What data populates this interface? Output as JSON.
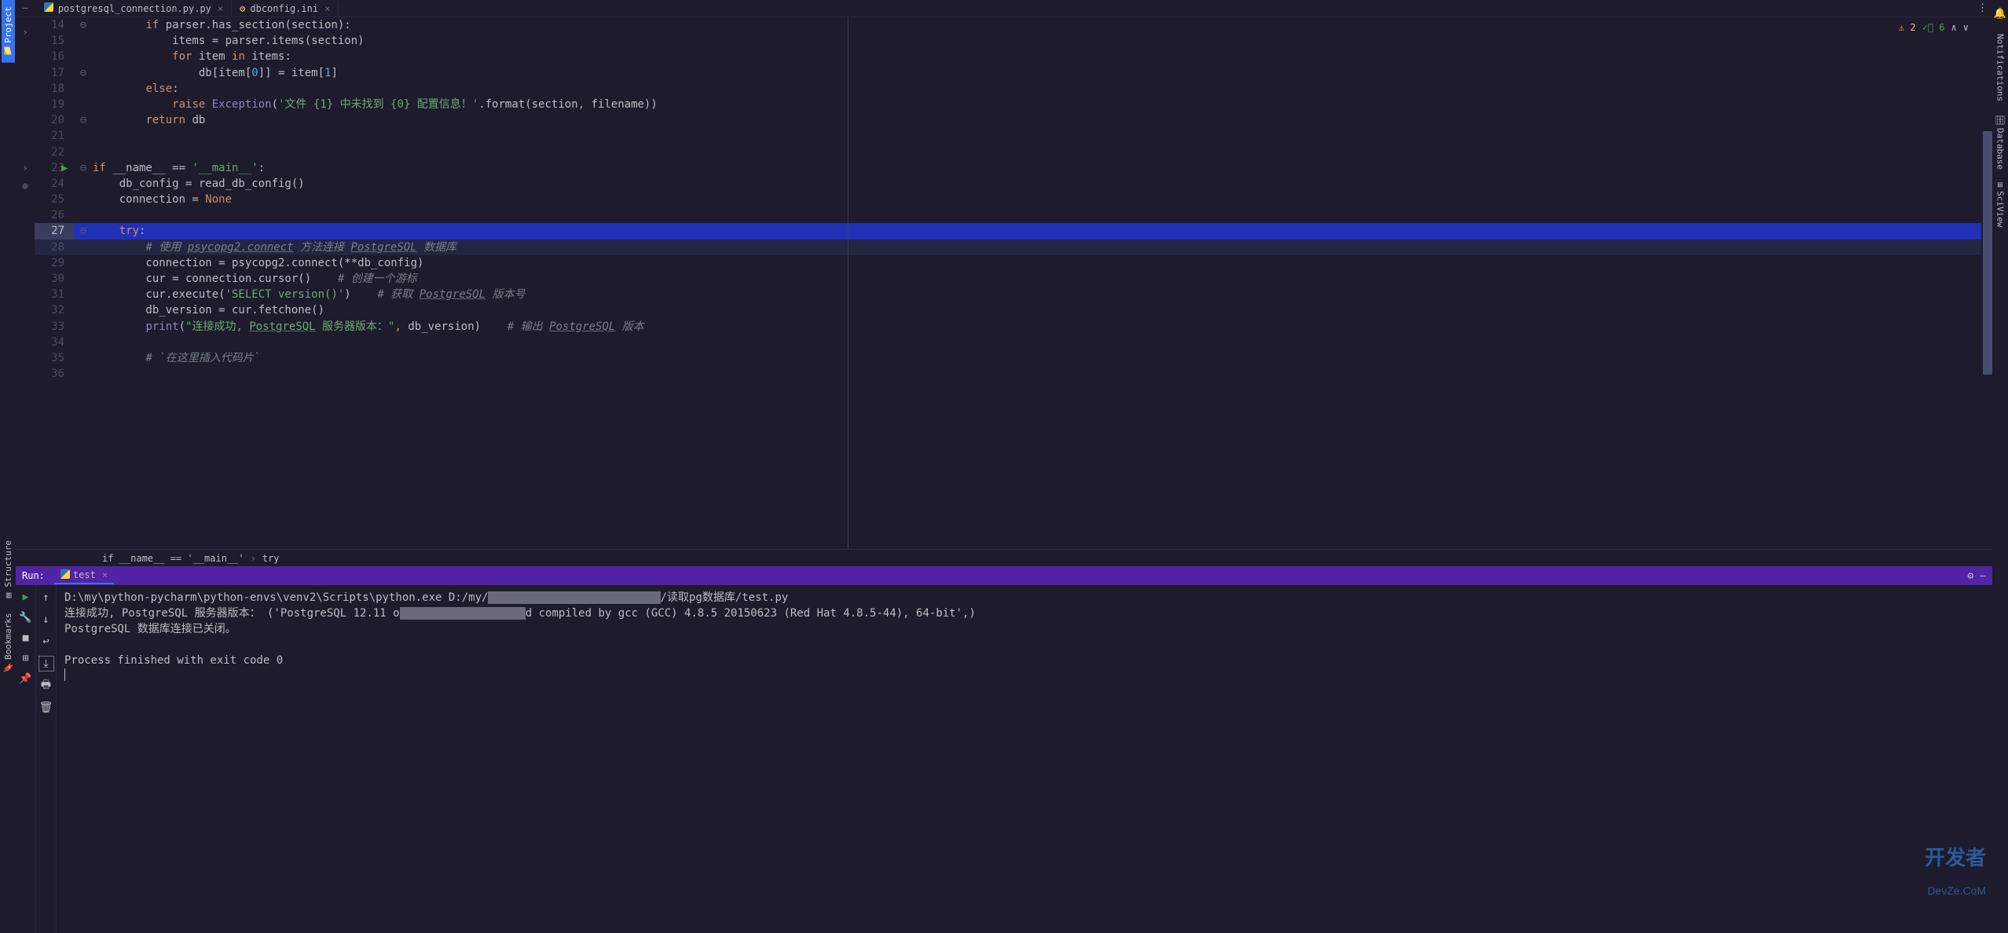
{
  "tabs": [
    {
      "name": "postgresql_connection.py.py",
      "active": true
    },
    {
      "name": "dbconfig.ini",
      "active": false
    }
  ],
  "left_tools": {
    "project": "Project",
    "structure": "Structure",
    "bookmarks": "Bookmarks"
  },
  "right_tools": {
    "notifications": "Notifications",
    "database": "Database",
    "sciview": "SciView"
  },
  "indicators": {
    "warnings": "2",
    "typos": "6"
  },
  "code": {
    "lines": [
      {
        "n": 14,
        "fold": "⊖",
        "segs": [
          [
            "",
            "        "
          ],
          [
            "kw",
            "if"
          ],
          [
            "",
            " parser.has_section(section):"
          ]
        ]
      },
      {
        "n": 15,
        "fold": "",
        "segs": [
          [
            "",
            "            items = parser.items(section)"
          ]
        ]
      },
      {
        "n": 16,
        "fold": "",
        "segs": [
          [
            "",
            "            "
          ],
          [
            "kw",
            "for"
          ],
          [
            "",
            " item "
          ],
          [
            "kw",
            "in"
          ],
          [
            "",
            " items:"
          ]
        ]
      },
      {
        "n": 17,
        "fold": "⊖",
        "segs": [
          [
            "",
            "                db[item["
          ],
          [
            "num",
            "0"
          ],
          [
            "",
            "]] = item["
          ],
          [
            "num",
            "1"
          ],
          [
            "",
            "]"
          ]
        ]
      },
      {
        "n": 18,
        "fold": "",
        "segs": [
          [
            "",
            "        "
          ],
          [
            "kw",
            "else"
          ],
          [
            "",
            ":"
          ]
        ]
      },
      {
        "n": 19,
        "fold": "",
        "segs": [
          [
            "",
            "            "
          ],
          [
            "kw",
            "raise"
          ],
          [
            "",
            " "
          ],
          [
            "builtin",
            "Exception"
          ],
          [
            "",
            "("
          ],
          [
            "str",
            "'文件 {1} 中未找到 {0} 配置信息！'"
          ],
          [
            "",
            ".format(section"
          ],
          [
            "kw",
            ","
          ],
          [
            "",
            " filename))"
          ]
        ]
      },
      {
        "n": 20,
        "fold": "⊖",
        "segs": [
          [
            "",
            "        "
          ],
          [
            "kw",
            "return"
          ],
          [
            "",
            " db"
          ]
        ]
      },
      {
        "n": 21,
        "fold": "",
        "segs": [
          [
            "",
            ""
          ]
        ]
      },
      {
        "n": 22,
        "fold": "",
        "segs": [
          [
            "",
            ""
          ]
        ]
      },
      {
        "n": 23,
        "fold": "⊖",
        "run": true,
        "segs": [
          [
            "kw",
            "if"
          ],
          [
            "",
            " __name__ == "
          ],
          [
            "str",
            "'__main__'"
          ],
          [
            "",
            ":"
          ]
        ]
      },
      {
        "n": 24,
        "fold": "",
        "segs": [
          [
            "",
            "    db_config = read_db_config()"
          ]
        ]
      },
      {
        "n": 25,
        "fold": "",
        "segs": [
          [
            "",
            "    connection = "
          ],
          [
            "kw",
            "None"
          ]
        ]
      },
      {
        "n": 26,
        "fold": "",
        "segs": [
          [
            "",
            ""
          ]
        ]
      },
      {
        "n": 27,
        "fold": "⊖",
        "current": true,
        "segs": [
          [
            "",
            "    "
          ],
          [
            "kw",
            "try"
          ],
          [
            "",
            ":"
          ]
        ]
      },
      {
        "n": 28,
        "fold": "",
        "hl": true,
        "segs": [
          [
            "",
            "        "
          ],
          [
            "cmt",
            "# 使用 "
          ],
          [
            "cmt ul",
            "psycopg2.connect"
          ],
          [
            "cmt",
            " 方法连接 "
          ],
          [
            "cmt ul",
            "PostgreSQL"
          ],
          [
            "cmt",
            " 数据库"
          ]
        ]
      },
      {
        "n": 29,
        "fold": "",
        "segs": [
          [
            "",
            "        connection = psycopg2.connect(**db_config)"
          ]
        ]
      },
      {
        "n": 30,
        "fold": "",
        "segs": [
          [
            "",
            "        cur = connection.cursor()    "
          ],
          [
            "cmt",
            "# 创建一个游标"
          ]
        ]
      },
      {
        "n": 31,
        "fold": "",
        "segs": [
          [
            "",
            "        cur.execute("
          ],
          [
            "str",
            "'SELECT version()'"
          ],
          [
            "",
            ")    "
          ],
          [
            "cmt",
            "# 获取 "
          ],
          [
            "cmt ul",
            "PostgreSQL"
          ],
          [
            "cmt",
            " 版本号"
          ]
        ]
      },
      {
        "n": 32,
        "fold": "",
        "segs": [
          [
            "",
            "        db_version = cur.fetchone()"
          ]
        ]
      },
      {
        "n": 33,
        "fold": "",
        "segs": [
          [
            "",
            "        "
          ],
          [
            "builtin",
            "print"
          ],
          [
            "",
            "("
          ],
          [
            "str",
            "\"连接成功, "
          ],
          [
            "str ul",
            "PostgreSQL"
          ],
          [
            "str",
            " 服务器版本：\""
          ],
          [
            "kw",
            ","
          ],
          [
            "",
            " db_version)    "
          ],
          [
            "cmt",
            "# 输出 "
          ],
          [
            "cmt ul",
            "PostgreSQL"
          ],
          [
            "cmt",
            " 版本"
          ]
        ]
      },
      {
        "n": 34,
        "fold": "",
        "segs": [
          [
            "",
            ""
          ]
        ]
      },
      {
        "n": 35,
        "fold": "",
        "segs": [
          [
            "",
            "        "
          ],
          [
            "cmt",
            "# `在这里插入代码片`"
          ]
        ]
      },
      {
        "n": 36,
        "fold": "",
        "segs": [
          [
            "",
            ""
          ]
        ]
      }
    ]
  },
  "breadcrumb": {
    "parts": [
      "if __name__ == '__main__'",
      "try"
    ]
  },
  "run_panel": {
    "title": "Run:",
    "tab": "test",
    "output": {
      "line1a": "D:\\my\\python-pycharm\\python-envs\\venv2\\Scripts\\python.exe D:/my/",
      "line1b": "/读取pg数据库/test.py",
      "line2a": "连接成功, PostgreSQL 服务器版本： ('PostgreSQL 12.11 o",
      "line2b": "d compiled by gcc (GCC) 4.8.5 20150623 (Red Hat 4.8.5-44), 64-bit',)",
      "line3": "PostgreSQL 数据库连接已关闭。",
      "line4": "",
      "line5": "Process finished with exit code 0"
    }
  },
  "watermark": {
    "cn": "开发者",
    "en": "DevZe.CoM"
  }
}
